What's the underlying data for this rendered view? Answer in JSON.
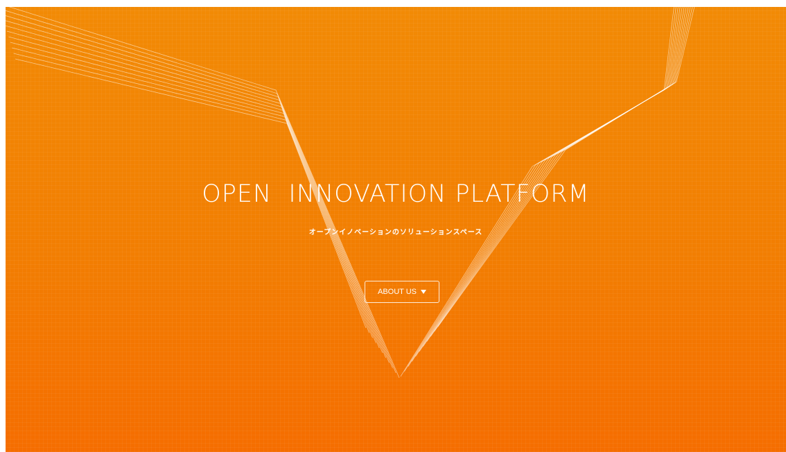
{
  "hero": {
    "title": "OPEN  INNOVATION PLATFORM",
    "subtitle": "オープンイノベーションのソリューションスペース",
    "button_label": "ABOUT US",
    "button_icon": "caret-down-icon"
  },
  "colors": {
    "background_top": "#f28a05",
    "background_bottom": "#f56d00",
    "text": "#ffffff",
    "line_art": "#ffffff"
  }
}
